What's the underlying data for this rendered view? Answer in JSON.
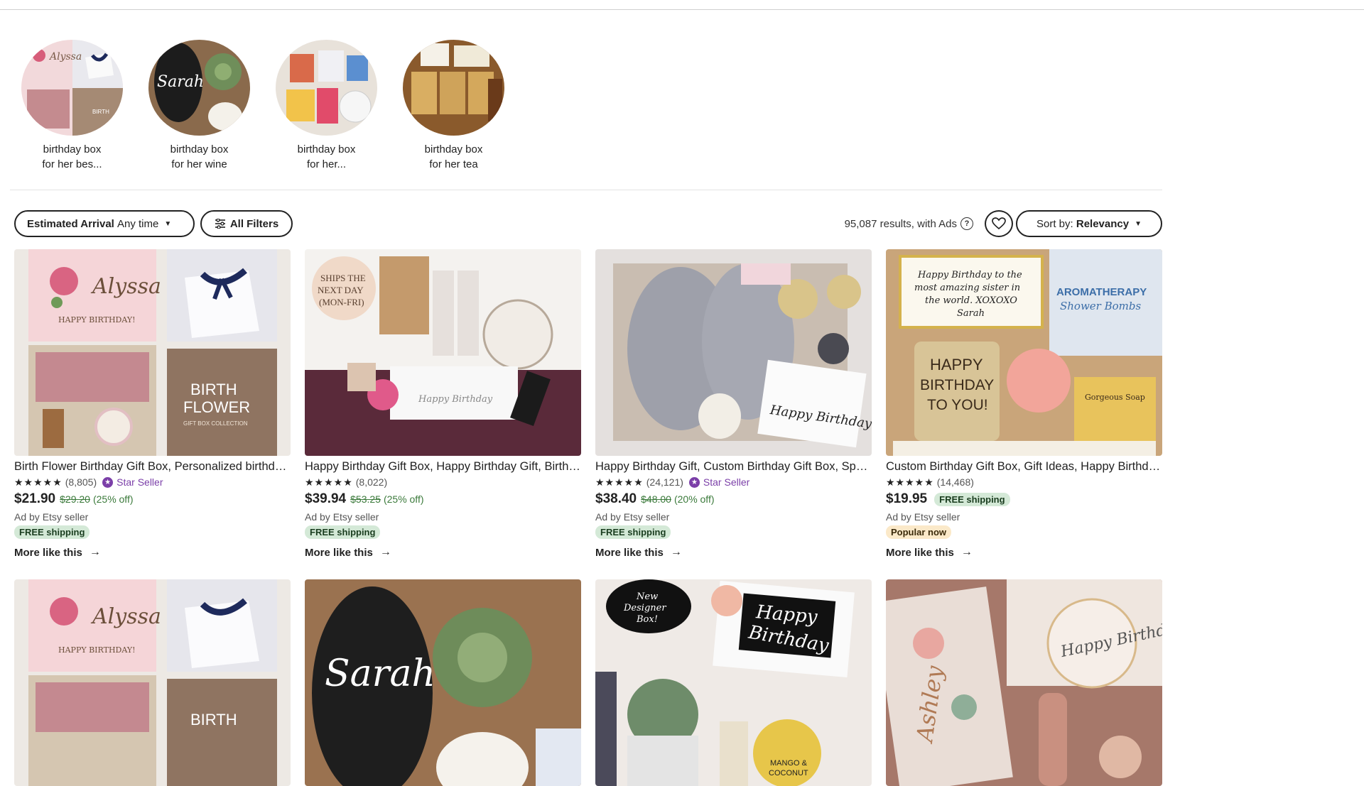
{
  "related_searches": [
    {
      "line1": "birthday box",
      "line2": "for her bes..."
    },
    {
      "line1": "birthday box",
      "line2": "for her wine"
    },
    {
      "line1": "birthday box",
      "line2": "for her..."
    },
    {
      "line1": "birthday box",
      "line2": "for her tea"
    }
  ],
  "filters": {
    "arrival_label": "Estimated Arrival",
    "arrival_value": "Any time",
    "all_filters_label": "All Filters",
    "results_text": "95,087 results, with Ads",
    "sort_label": "Sort by:",
    "sort_value": "Relevancy"
  },
  "listings": [
    {
      "title": "Birth Flower Birthday Gift Box, Personalized birthday gift box",
      "stars": "★★★★★",
      "reviews": "(8,805)",
      "star_seller": "Star Seller",
      "price": "$21.90",
      "original_price": "$29.20",
      "discount": "(25% off)",
      "ad_text": "Ad by Etsy seller",
      "badge": "FREE shipping",
      "more_like": "More like this"
    },
    {
      "title": "Happy Birthday Gift Box, Happy Birthday Gift, Birthday Box",
      "stars": "★★★★★",
      "reviews": "(8,022)",
      "price": "$39.94",
      "original_price": "$53.25",
      "discount": "(25% off)",
      "ad_text": "Ad by Etsy seller",
      "badge": "FREE shipping",
      "more_like": "More like this"
    },
    {
      "title": "Happy Birthday Gift, Custom Birthday Gift Box, Spa Gift Box",
      "stars": "★★★★★",
      "reviews": "(24,121)",
      "star_seller": "Star Seller",
      "price": "$38.40",
      "original_price": "$48.00",
      "discount": "(20% off)",
      "ad_text": "Ad by Etsy seller",
      "badge": "FREE shipping",
      "more_like": "More like this"
    },
    {
      "title": "Custom Birthday Gift Box, Gift Ideas, Happy Birthday Box",
      "stars": "★★★★★",
      "reviews": "(14,468)",
      "price": "$19.95",
      "inline_badge": "FREE shipping",
      "ad_text": "Ad by Etsy seller",
      "popular": "Popular now",
      "more_like": "More like this"
    }
  ],
  "image_text": {
    "alyssa": "Alyssa",
    "happy_birthday_caps": "HAPPY BIRTHDAY!",
    "birth": "BIRTH",
    "flower": "FLOWER",
    "gift_box_collection": "GIFT BOX COLLECTION",
    "ships_line1": "SHIPS THE",
    "ships_line2": "NEXT DAY",
    "ships_line3": "(MON-FRI)",
    "happy_birthday_script": "Happy Birthday",
    "card_line1": "Happy Birthday to the",
    "card_line2": "most amazing sister in",
    "card_line3": "the world. XOXOXO",
    "card_line4": "Sarah",
    "candle_line1": "HAPPY",
    "candle_line2": "BIRTHDAY",
    "candle_line3": "TO YOU!",
    "aroma_line1": "AROMATHERAPY",
    "aroma_line2": "Shower Bombs",
    "soap": "Gorgeous Soap",
    "sarah": "Sarah",
    "new_designer_1": "New",
    "new_designer_2": "Designer",
    "new_designer_3": "Box!",
    "happy": "Happy",
    "birthday": "Birthday",
    "mango": "MANGO &",
    "coconut": "COCONUT",
    "ashley": "Ashley",
    "happy_birthday_excl": "Happy Birthday!"
  }
}
